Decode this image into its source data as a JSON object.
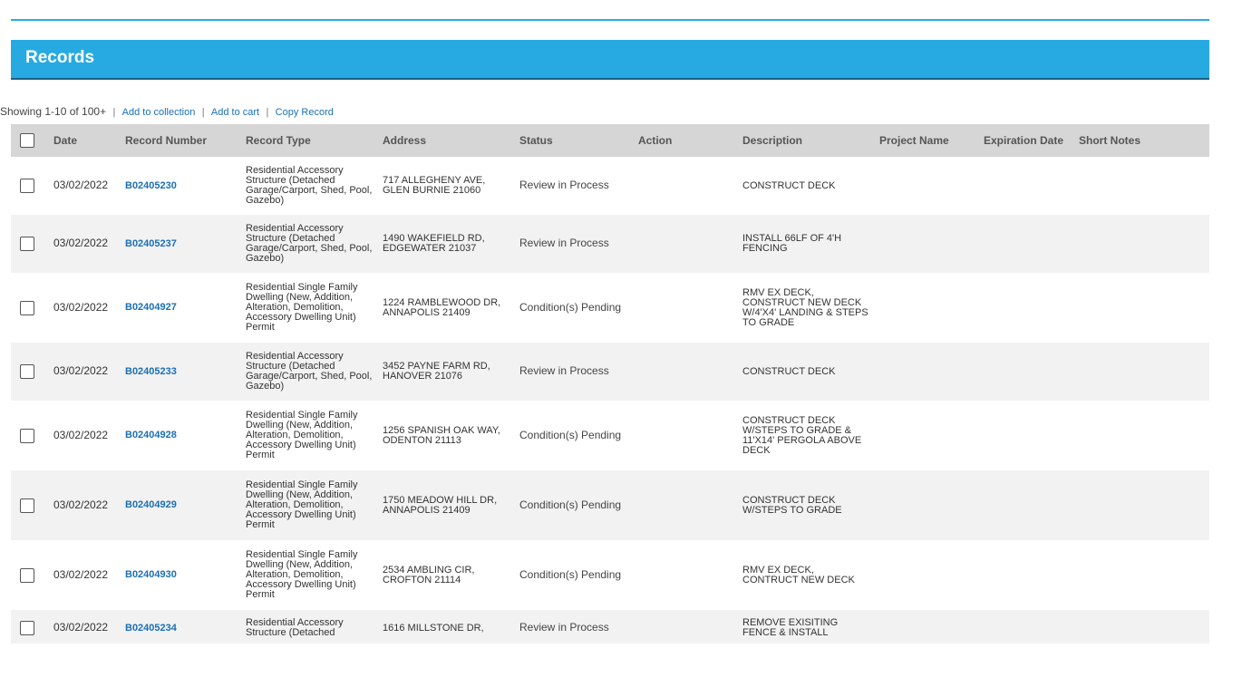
{
  "header": {
    "title": "Records"
  },
  "toolbar": {
    "count_text": "Showing 1-10 of 100+",
    "add_to_collection": "Add to collection",
    "add_to_cart": "Add to cart",
    "copy_record": "Copy Record",
    "separator": "|"
  },
  "table": {
    "columns": [
      "Date",
      "Record Number",
      "Record Type",
      "Address",
      "Status",
      "Action",
      "Description",
      "Project Name",
      "Expiration Date",
      "Short Notes"
    ],
    "rows": [
      {
        "date": "03/02/2022",
        "record_number": "B02405230",
        "record_type": "Residential Accessory Structure (Detached Garage/Carport, Shed, Pool, Gazebo)",
        "address": "717 ALLEGHENY AVE, GLEN BURNIE 21060",
        "status": "Review in Process",
        "action": "",
        "description": "CONSTRUCT DECK",
        "project_name": "",
        "expiration_date": "",
        "short_notes": ""
      },
      {
        "date": "03/02/2022",
        "record_number": "B02405237",
        "record_type": "Residential Accessory Structure (Detached Garage/Carport, Shed, Pool, Gazebo)",
        "address": "1490 WAKEFIELD RD, EDGEWATER 21037",
        "status": "Review in Process",
        "action": "",
        "description": "INSTALL 66LF OF 4'H FENCING",
        "project_name": "",
        "expiration_date": "",
        "short_notes": ""
      },
      {
        "date": "03/02/2022",
        "record_number": "B02404927",
        "record_type": "Residential Single Family Dwelling (New, Addition, Alteration, Demolition, Accessory Dwelling Unit) Permit",
        "address": "1224 RAMBLEWOOD DR, ANNAPOLIS 21409",
        "status": "Condition(s) Pending",
        "action": "",
        "description": "RMV EX DECK, CONSTRUCT NEW DECK W/4'X4' LANDING & STEPS TO GRADE",
        "project_name": "",
        "expiration_date": "",
        "short_notes": ""
      },
      {
        "date": "03/02/2022",
        "record_number": "B02405233",
        "record_type": "Residential Accessory Structure (Detached Garage/Carport, Shed, Pool, Gazebo)",
        "address": "3452 PAYNE FARM RD, HANOVER 21076",
        "status": "Review in Process",
        "action": "",
        "description": "CONSTRUCT DECK",
        "project_name": "",
        "expiration_date": "",
        "short_notes": ""
      },
      {
        "date": "03/02/2022",
        "record_number": "B02404928",
        "record_type": "Residential Single Family Dwelling (New, Addition, Alteration, Demolition, Accessory Dwelling Unit) Permit",
        "address": "1256 SPANISH OAK WAY, ODENTON 21113",
        "status": "Condition(s) Pending",
        "action": "",
        "description": "CONSTRUCT DECK W/STEPS TO GRADE & 11'X14' PERGOLA ABOVE DECK",
        "project_name": "",
        "expiration_date": "",
        "short_notes": ""
      },
      {
        "date": "03/02/2022",
        "record_number": "B02404929",
        "record_type": "Residential Single Family Dwelling (New, Addition, Alteration, Demolition, Accessory Dwelling Unit) Permit",
        "address": "1750 MEADOW HILL DR, ANNAPOLIS 21409",
        "status": "Condition(s) Pending",
        "action": "",
        "description": "CONSTRUCT DECK W/STEPS TO GRADE",
        "project_name": "",
        "expiration_date": "",
        "short_notes": ""
      },
      {
        "date": "03/02/2022",
        "record_number": "B02404930",
        "record_type": "Residential Single Family Dwelling (New, Addition, Alteration, Demolition, Accessory Dwelling Unit) Permit",
        "address": "2534 AMBLING CIR, CROFTON 21114",
        "status": "Condition(s) Pending",
        "action": "",
        "description": "RMV EX DECK, CONTRUCT NEW DECK",
        "project_name": "",
        "expiration_date": "",
        "short_notes": ""
      },
      {
        "date": "03/02/2022",
        "record_number": "B02405234",
        "record_type": "Residential Accessory Structure (Detached",
        "address": "1616 MILLSTONE DR,",
        "status": "Review in Process",
        "action": "",
        "description": "REMOVE EXISITING FENCE & INSTALL",
        "project_name": "",
        "expiration_date": "",
        "short_notes": ""
      }
    ]
  }
}
